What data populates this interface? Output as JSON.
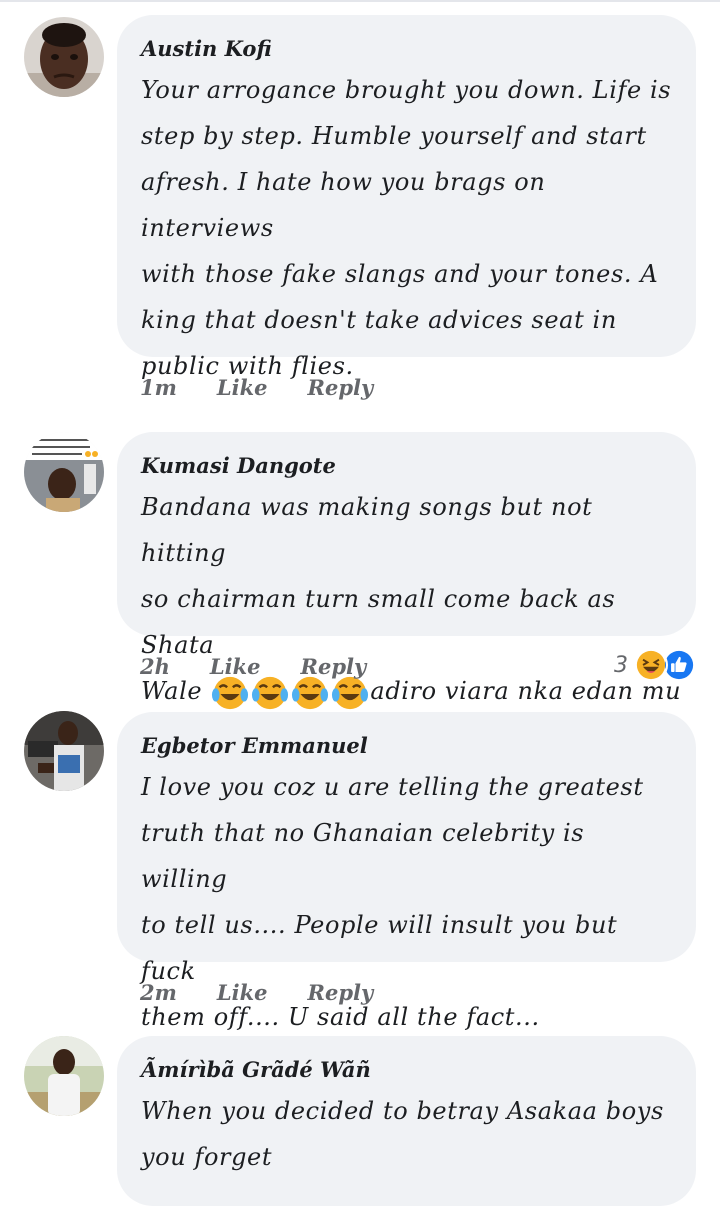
{
  "comments": [
    {
      "author": "Austin Kofi",
      "text": "Your arrogance brought you down. Life is\nstep by step.  Humble yourself and start\nafresh. I hate how you brags on interviews\nwith those fake slangs and your tones. A\nking that doesn't take advices seat in\npublic with flies.",
      "time": "1m",
      "like": "Like",
      "reply": "Reply",
      "avatar_icon": "person-photo-avatar"
    },
    {
      "author": "Kumasi Dangote",
      "text_lines": [
        "Bandana was making songs but not hitting",
        "so chairman turn small come back as Shata"
      ],
      "text_last_prefix": "Wale",
      "text_last_suffix": "adiro viara nka edan mu",
      "emoji_icon": "face-with-tears-of-joy-emoji",
      "emoji_count": 4,
      "time": "2h",
      "like": "Like",
      "reply": "Reply",
      "reaction_count": "3",
      "reaction_icons": [
        "laughing-face-icon",
        "thumbs-up-icon"
      ],
      "avatar_icon": "meme-screenshot-avatar"
    },
    {
      "author": "Egbetor Emmanuel",
      "text": "I love you coz u are telling the greatest\ntruth that no Ghanaian celebrity is willing\nto tell us.... People will insult you but fuck\nthem off.... U said all the fact...",
      "time": "2m",
      "like": "Like",
      "reply": "Reply",
      "avatar_icon": "person-photo-avatar"
    },
    {
      "author": "Ãmírìbã Grãdé Wãñ",
      "text": "When you decided to betray Asakaa boys\nyou forget",
      "avatar_icon": "person-photo-avatar"
    }
  ],
  "colors": {
    "bubble": "#f0f2f5",
    "meta_text": "#65676b",
    "like_blue": "#1877f2",
    "haha_yellow": "#f7b125"
  }
}
